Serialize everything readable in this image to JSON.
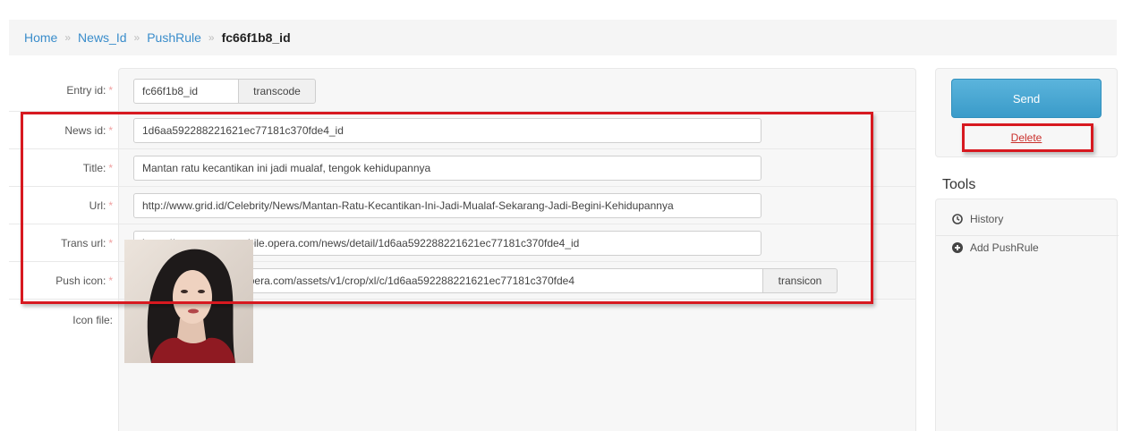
{
  "breadcrumb": {
    "home": "Home",
    "news": "News_Id",
    "pushrule": "PushRule",
    "current": "fc66f1b8_id",
    "separator": "»"
  },
  "form": {
    "entry_id": {
      "label": "Entry id:",
      "value": "fc66f1b8_id",
      "button": "transcode"
    },
    "news_id": {
      "label": "News id:",
      "value": "1d6aa592288221621ec77181c370fde4_id"
    },
    "title": {
      "label": "Title:",
      "value": "Mantan ratu kecantikan ini jadi mualaf, tengok kehidupannya"
    },
    "url": {
      "label": "Url:",
      "value": "http://www.grid.id/Celebrity/News/Mantan-Ratu-Kecantikan-Ini-Jadi-Mualaf-Sekarang-Jadi-Begini-Kehidupannya"
    },
    "trans_url": {
      "label": "Trans url:",
      "value": "https://news-sg.op-mobile.opera.com/news/detail/1d6aa592288221621ec77181c370fde4_id"
    },
    "push_icon": {
      "label": "Push icon:",
      "value": "http://img.transcoder.opera.com/assets/v1/crop/xl/c/1d6aa592288221621ec77181c370fde4",
      "button": "transicon"
    },
    "icon_file": {
      "label": "Icon file:"
    },
    "required_mark": "*"
  },
  "sidebar": {
    "send": "Send",
    "delete": "Delete",
    "tools_title": "Tools",
    "tools": [
      {
        "label": "History",
        "icon": "clock-icon"
      },
      {
        "label": "Add PushRule",
        "icon": "plus-circle-icon"
      }
    ]
  },
  "colors": {
    "link": "#3a8dcb",
    "send_button": "#3a9bc9",
    "delete": "#c9302c",
    "annotation": "#d71920"
  }
}
